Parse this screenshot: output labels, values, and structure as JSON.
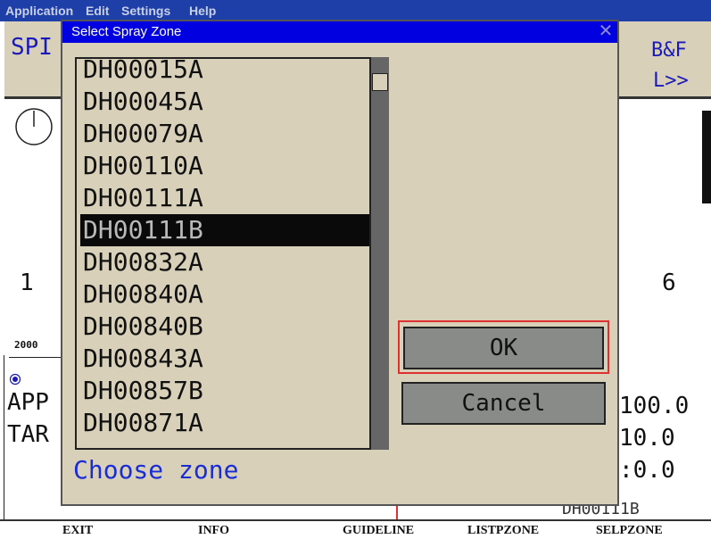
{
  "menubar": {
    "application": "Application",
    "edit": "Edit",
    "settings": "Settings",
    "help": "Help"
  },
  "background": {
    "spr_label": "SPI",
    "bf_label": "B&F",
    "l_label": "L>>",
    "left_number": "1",
    "right_number": "6",
    "scale_label": "2000",
    "app_label": "APP",
    "tar_label": "TAR",
    "app_value": "100.0",
    "tar_value": "10.0",
    "third_value": ":0.0",
    "zone_readout": "DH00111B"
  },
  "softkeys": [
    "EXIT",
    "INFO",
    "GUIDELINE",
    "LISTPZONE",
    "SELPZONE"
  ],
  "dialog": {
    "title": "Select Spray Zone",
    "close_glyph": "✕",
    "ok_label": "OK",
    "cancel_label": "Cancel",
    "prompt": "Choose zone",
    "zones": [
      "DH00015A",
      "DH00045A",
      "DH00079A",
      "DH00110A",
      "DH00111A",
      "DH00111B",
      "DH00832A",
      "DH00840A",
      "DH00840B",
      "DH00843A",
      "DH00857B",
      "DH00871A"
    ],
    "selected_zone": "DH00111B"
  },
  "colors": {
    "dialog_bg": "#d8d0b8",
    "title_bar": "#0000e0",
    "selection_bg": "#0a0a0a",
    "prompt_text": "#1a2cd6",
    "focus_border": "#e03030"
  }
}
